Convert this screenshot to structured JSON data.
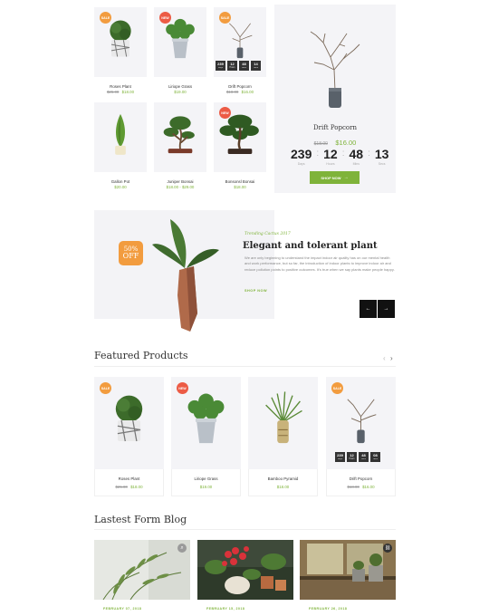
{
  "top_grid": [
    {
      "name": "Roses Plant",
      "old": "$25.00",
      "new": "$18.00",
      "badge": "SALE",
      "badge_color": "orange",
      "plant": "topiary"
    },
    {
      "name": "Liriope Grass",
      "old": "",
      "new": "$19.00",
      "badge": "NEW",
      "badge_color": "red",
      "plant": "bush"
    },
    {
      "name": "Drift Popcorn",
      "old": "$18.00",
      "new": "$16.00",
      "badge": "SALE",
      "badge_color": "orange",
      "plant": "twig",
      "countdown": [
        {
          "v": "239",
          "l": "Days"
        },
        {
          "v": "12",
          "l": "Hours"
        },
        {
          "v": "48",
          "l": "Mins"
        },
        {
          "v": "14",
          "l": "Secs"
        }
      ]
    },
    {
      "name": "Gallon Pot",
      "old": "",
      "new": "$20.00",
      "badge": "",
      "plant": "cypress"
    },
    {
      "name": "Juniper Bonsai",
      "old": "",
      "new": "$18.00 - $29.00",
      "badge": "",
      "plant": "bonsai"
    },
    {
      "name": "Bonsonsl Bonsai",
      "old": "",
      "new": "$18.00",
      "badge": "NEW",
      "badge_color": "red",
      "plant": "bonsai2"
    }
  ],
  "featured_big": {
    "name": "Drift Popcorn",
    "old": "$18.00",
    "new": "$16.00",
    "countdown": [
      {
        "v": "239",
        "l": "Days"
      },
      {
        "v": "12",
        "l": "Hours"
      },
      {
        "v": "48",
        "l": "Mins"
      },
      {
        "v": "13",
        "l": "Secs"
      }
    ],
    "button": "SHOP NOW"
  },
  "banner": {
    "badge_line1": "50%",
    "badge_line2": "OFF",
    "script": "Trending Cactus 2017",
    "title": "Elegant and tolerant plant",
    "body": "We are only beginning to understand the impact indoor air quality has on our mental health and work performance, but so far, the introduction of indoor plants to improve indoor air and reduce pollution points to positive outcomes. It's true when we say plants make people happy.",
    "link": "SHOP NOW",
    "prev_icon": "arrow-left-icon",
    "next_icon": "arrow-right-icon"
  },
  "featured": {
    "heading": "Featured Products",
    "products": [
      {
        "name": "Roses Plant",
        "old": "$25.00",
        "new": "$18.00",
        "badge": "SALE",
        "badge_color": "orange",
        "plant": "topiary"
      },
      {
        "name": "Liriope Grass",
        "old": "",
        "new": "$19.00",
        "badge": "NEW",
        "badge_color": "red",
        "plant": "bush"
      },
      {
        "name": "Bamboo Pyramid",
        "old": "",
        "new": "$18.00",
        "badge": "",
        "plant": "grass"
      },
      {
        "name": "Drift Popcorn",
        "old": "$18.00",
        "new": "$16.00",
        "badge": "SALE",
        "badge_color": "orange",
        "plant": "twig",
        "countdown": [
          {
            "v": "239",
            "l": "Days"
          },
          {
            "v": "12",
            "l": "Hours"
          },
          {
            "v": "48",
            "l": "Mins"
          },
          {
            "v": "08",
            "l": "Secs"
          }
        ]
      }
    ]
  },
  "blog": {
    "heading": "Lastest Form Blog",
    "posts": [
      {
        "date": "FEBRUARY 07, 2018",
        "icon": "search-icon"
      },
      {
        "date": "FEBRUARY 15, 2018",
        "icon": ""
      },
      {
        "date": "FEBRUARY 26, 2018",
        "icon": "link-icon"
      }
    ]
  },
  "colors": {
    "accent": "#7fb33a",
    "sale": "#f29c3f",
    "new": "#ec5b45",
    "card_bg": "#f4f4f7",
    "dark": "#222222"
  }
}
